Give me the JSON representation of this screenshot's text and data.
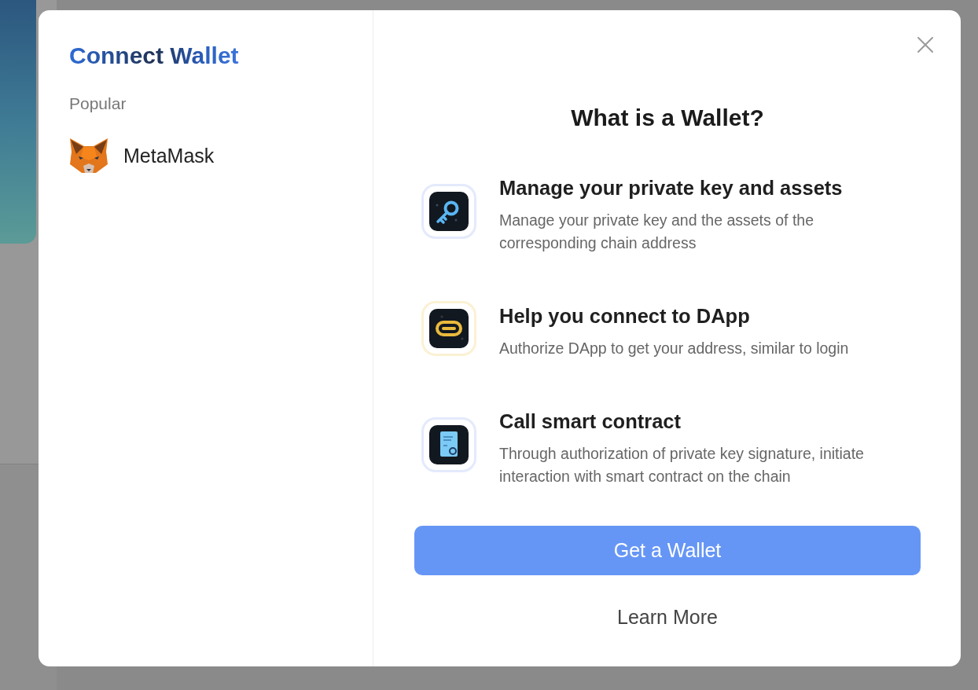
{
  "sidebar": {
    "title": "Connect Wallet",
    "section_label": "Popular",
    "wallets": [
      {
        "name": "MetaMask"
      }
    ]
  },
  "info_panel": {
    "heading": "What is a Wallet?",
    "features": [
      {
        "kind": "key",
        "title": "Manage your private key and assets",
        "description": "Manage your private key and the assets of the corresponding chain address"
      },
      {
        "kind": "link",
        "title": "Help you connect to DApp",
        "description": "Authorize DApp to get your address, similar to login"
      },
      {
        "kind": "contract",
        "title": "Call smart contract",
        "description": "Through authorization of private key signature, initiate interaction with smart contract on the chain"
      }
    ],
    "primary_button": "Get a Wallet",
    "secondary_button": "Learn More"
  }
}
